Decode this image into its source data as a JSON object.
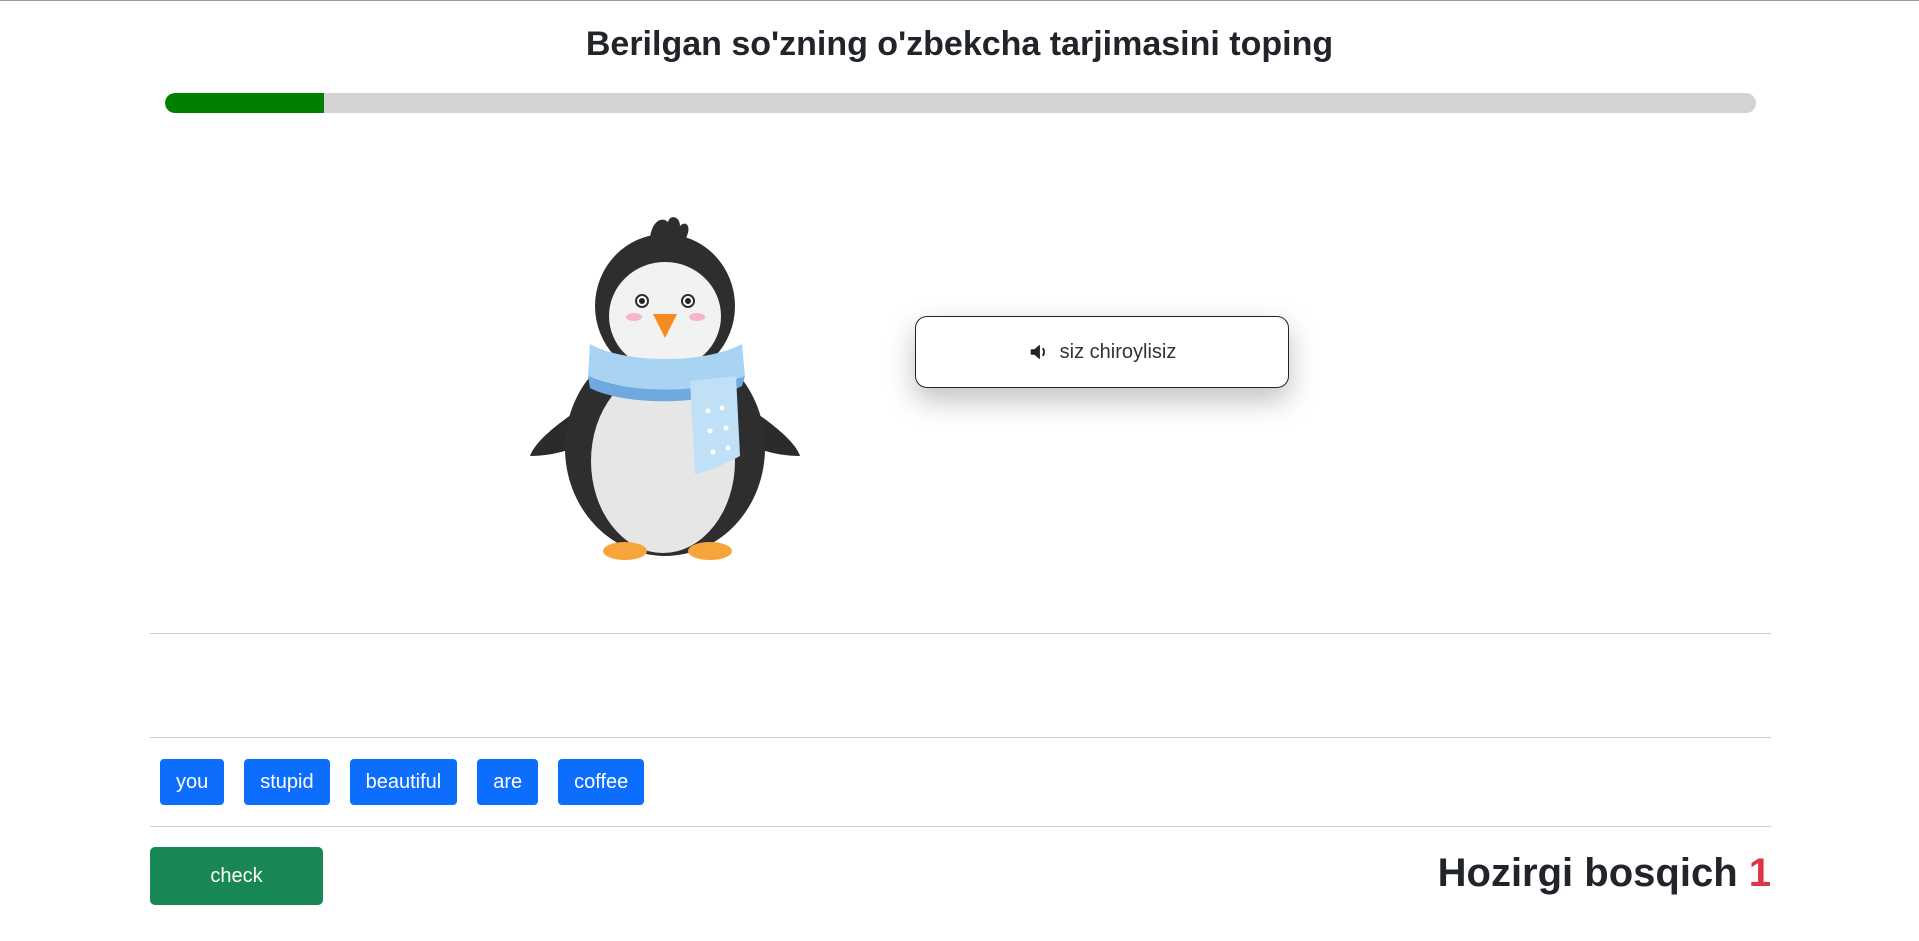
{
  "header": {
    "title": "Berilgan so'zning o'zbekcha tarjimasini toping"
  },
  "progress": {
    "fraction": 0.1,
    "color": "#008000",
    "track_color": "#d3d3d3"
  },
  "illustration": {
    "icon": "penguin-with-scarf"
  },
  "prompt": {
    "icon": "speaker-icon",
    "text": "siz chiroylisiz"
  },
  "word_bank": {
    "words": [
      "you",
      "stupid",
      "beautiful",
      "are",
      "coffee"
    ],
    "button_color": "#0d6efd"
  },
  "footer": {
    "check_label": "check",
    "check_color": "#198754",
    "stage_label": "Hozirgi bosqich",
    "stage_number": "1",
    "stage_number_color": "#dc3545"
  }
}
